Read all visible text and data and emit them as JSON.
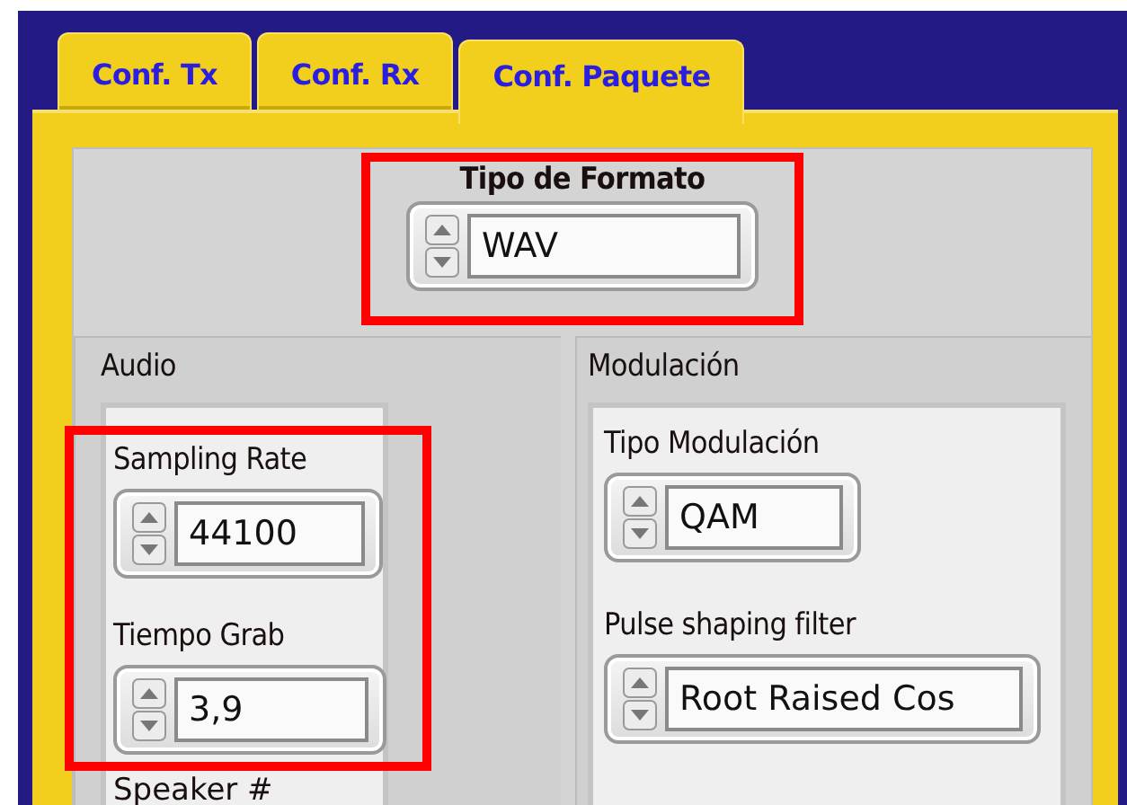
{
  "tabs": [
    {
      "label": "Conf. Tx",
      "selected": false
    },
    {
      "label": "Conf. Rx",
      "selected": false
    },
    {
      "label": "Conf. Paquete",
      "selected": true
    }
  ],
  "format": {
    "label": "Tipo de Formato",
    "value": "WAV"
  },
  "audio": {
    "title": "Audio",
    "controls": [
      {
        "label": "Sampling Rate",
        "value": "44100"
      },
      {
        "label": "Tiempo Grab",
        "value": "3,9"
      }
    ],
    "cut_label": "Speaker #"
  },
  "modulation": {
    "title": "Modulación",
    "controls": [
      {
        "label": "Tipo Modulación",
        "value": "QAM"
      },
      {
        "label": "Pulse shaping filter",
        "value": "Root Raised Cos"
      }
    ]
  }
}
